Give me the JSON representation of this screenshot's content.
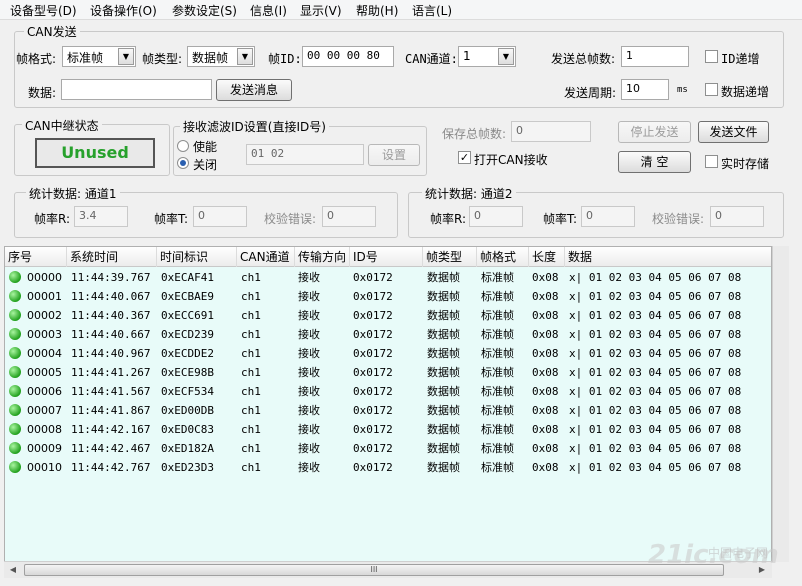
{
  "menu": [
    "设备型号(D)",
    "设备操作(O)",
    "参数设定(S)",
    "信息(I)",
    "显示(V)",
    "帮助(H)",
    "语言(L)"
  ],
  "can_send": {
    "title": "CAN发送",
    "frame_format_label": "帧格式:",
    "frame_format_value": "标准帧",
    "frame_type_label": "帧类型:",
    "frame_type_value": "数据帧",
    "frame_id_label": "帧ID:",
    "frame_id_value": "00 00 00 80",
    "can_channel_label": "CAN通道:",
    "can_channel_value": "1",
    "total_frames_label": "发送总帧数:",
    "total_frames_value": "1",
    "id_increment_label": "ID递增",
    "data_label": "数据:",
    "data_value": "",
    "send_button": "发送消息",
    "period_label": "发送周期:",
    "period_value": "10",
    "period_unit": "ms",
    "data_increment_label": "数据递增"
  },
  "relay": {
    "title": "CAN中继状态",
    "status": "Unused"
  },
  "filter": {
    "title": "接收滤波ID设置(直接ID号)",
    "enable_label": "使能",
    "close_label": "关闭",
    "ids_value": "01 02",
    "set_button": "设置"
  },
  "save_frames_label": "保存总帧数:",
  "save_frames_value": "0",
  "open_can_receive_label": "打开CAN接收",
  "open_can_receive_check": "✓",
  "stop_send_button": "停止发送",
  "send_file_button": "发送文件",
  "clear_button": "清 空",
  "realtime_save_label": "实时存储",
  "stats1": {
    "title": "统计数据: 通道1",
    "rate_r_label": "帧率R:",
    "rate_r_value": "3.4",
    "rate_t_label": "帧率T:",
    "rate_t_value": "0",
    "check_err_label": "校验错误:",
    "check_err_value": "0"
  },
  "stats2": {
    "title": "统计数据: 通道2",
    "rate_r_label": "帧率R:",
    "rate_r_value": "0",
    "rate_t_label": "帧率T:",
    "rate_t_value": "0",
    "check_err_label": "校验错误:",
    "check_err_value": "0"
  },
  "table": {
    "columns": [
      "序号",
      "系统时间",
      "时间标识",
      "CAN通道",
      "传输方向",
      "ID号",
      "帧类型",
      "帧格式",
      "长度",
      "数据"
    ],
    "rows": [
      [
        "00000",
        "11:44:39.767",
        "0xECAF41",
        "ch1",
        "接收",
        "0x0172",
        "数据帧",
        "标准帧",
        "0x08",
        "x| 01 02 03 04 05 06 07 08"
      ],
      [
        "00001",
        "11:44:40.067",
        "0xECBAE9",
        "ch1",
        "接收",
        "0x0172",
        "数据帧",
        "标准帧",
        "0x08",
        "x| 01 02 03 04 05 06 07 08"
      ],
      [
        "00002",
        "11:44:40.367",
        "0xECC691",
        "ch1",
        "接收",
        "0x0172",
        "数据帧",
        "标准帧",
        "0x08",
        "x| 01 02 03 04 05 06 07 08"
      ],
      [
        "00003",
        "11:44:40.667",
        "0xECD239",
        "ch1",
        "接收",
        "0x0172",
        "数据帧",
        "标准帧",
        "0x08",
        "x| 01 02 03 04 05 06 07 08"
      ],
      [
        "00004",
        "11:44:40.967",
        "0xECDDE2",
        "ch1",
        "接收",
        "0x0172",
        "数据帧",
        "标准帧",
        "0x08",
        "x| 01 02 03 04 05 06 07 08"
      ],
      [
        "00005",
        "11:44:41.267",
        "0xECE98B",
        "ch1",
        "接收",
        "0x0172",
        "数据帧",
        "标准帧",
        "0x08",
        "x| 01 02 03 04 05 06 07 08"
      ],
      [
        "00006",
        "11:44:41.567",
        "0xECF534",
        "ch1",
        "接收",
        "0x0172",
        "数据帧",
        "标准帧",
        "0x08",
        "x| 01 02 03 04 05 06 07 08"
      ],
      [
        "00007",
        "11:44:41.867",
        "0xED00DB",
        "ch1",
        "接收",
        "0x0172",
        "数据帧",
        "标准帧",
        "0x08",
        "x| 01 02 03 04 05 06 07 08"
      ],
      [
        "00008",
        "11:44:42.167",
        "0xED0C83",
        "ch1",
        "接收",
        "0x0172",
        "数据帧",
        "标准帧",
        "0x08",
        "x| 01 02 03 04 05 06 07 08"
      ],
      [
        "00009",
        "11:44:42.467",
        "0xED182A",
        "ch1",
        "接收",
        "0x0172",
        "数据帧",
        "标准帧",
        "0x08",
        "x| 01 02 03 04 05 06 07 08"
      ],
      [
        "00010",
        "11:44:42.767",
        "0xED23D3",
        "ch1",
        "接收",
        "0x0172",
        "数据帧",
        "标准帧",
        "0x08",
        "x| 01 02 03 04 05 06 07 08"
      ]
    ]
  },
  "hscroll_grip": "III",
  "watermark": "21ic.com",
  "watermark_sub": "中国电子网",
  "colors": {
    "status_green": "#27a12c",
    "table_bg": "#e8fbf9",
    "row_dot": "#22a11e"
  }
}
